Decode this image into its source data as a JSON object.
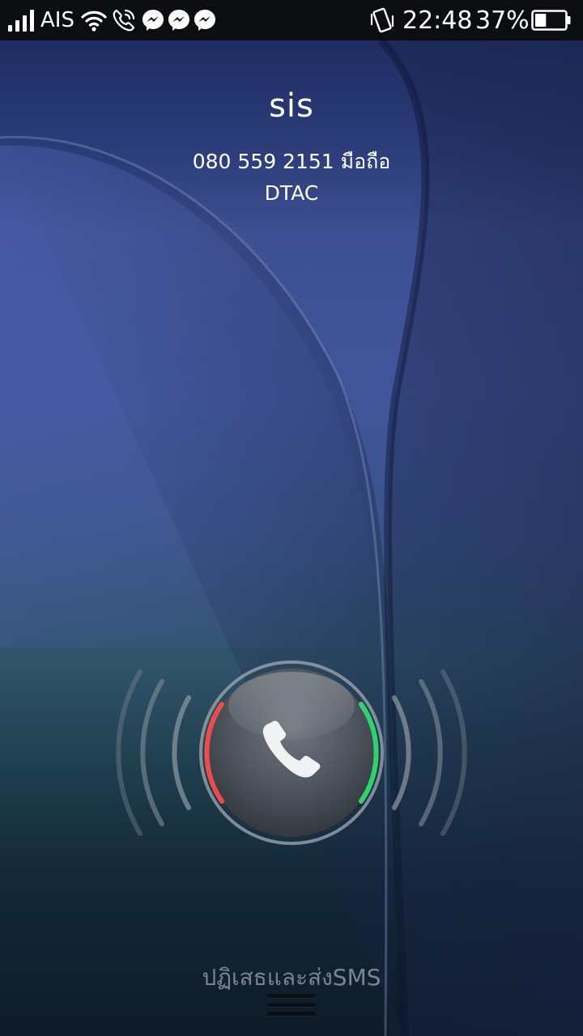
{
  "status_bar": {
    "carrier": "AIS",
    "time": "22:48",
    "battery_percent": "37%",
    "battery_level": 0.37,
    "icons": [
      "signal-icon",
      "wifi-icon",
      "call-status-icon",
      "messenger-icon",
      "messenger-icon",
      "messenger-icon",
      "vibrate-icon",
      "battery-icon"
    ]
  },
  "caller": {
    "name": "sis",
    "number_line": "080 559 2151 มือถือ",
    "carrier": "DTAC"
  },
  "answer_widget": {
    "icon": "phone-icon",
    "reject_color": "#ee4b4b",
    "accept_color": "#2fd36b"
  },
  "bottom": {
    "reject_with_sms_label": "ปฏิเสธและส่งSMS"
  }
}
